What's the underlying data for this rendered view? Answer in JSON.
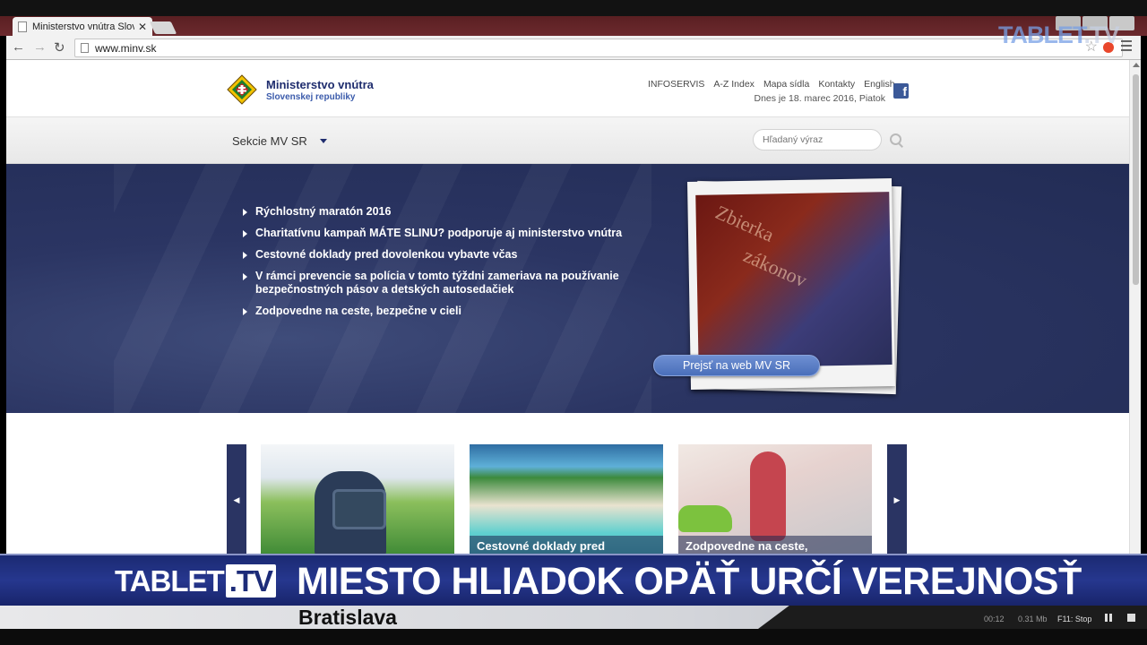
{
  "browser": {
    "tab_title": "Ministerstvo vnútra Slove",
    "tab_close": "✕",
    "url": "www.minv.sk",
    "back": "←",
    "forward": "→",
    "reload": "↻",
    "star": "☆"
  },
  "header": {
    "org_name": "Ministerstvo vnútra",
    "org_sub": "Slovenskej republiky",
    "links": [
      "INFOSERVIS",
      "A-Z Index",
      "Mapa sídla",
      "Kontakty",
      "English"
    ],
    "date_line": "Dnes je 18. marec 2016, Piatok",
    "fb": "f"
  },
  "nav": {
    "sections_label": "Sekcie MV SR",
    "search_placeholder": "Hľadaný výraz"
  },
  "banner": {
    "news": [
      "Rýchlostný maratón 2016",
      "Charitatívnu kampaň MÁTE SLINU? podporuje aj ministerstvo vnútra",
      "Cestovné doklady pred dovolenkou vybavte včas",
      "V rámci prevencie sa polícia v tomto týždni zameriava na používanie bezpečnostných pásov a detských autosedačiek",
      "Zodpovedne na ceste, bezpečne v cieli"
    ],
    "button_label": "Prejsť na web MV SR"
  },
  "carousel": {
    "prev": "◀",
    "next": "▶",
    "items": [
      {
        "caption": ""
      },
      {
        "caption": "Cestovné doklady pred"
      },
      {
        "caption": "Zodpovedne na ceste,"
      }
    ]
  },
  "tv": {
    "logo_main": "TABLET",
    "logo_tv": ".TV",
    "headline": "MIESTO HLIADOK OPÄŤ URČÍ VEREJNOSŤ",
    "location": "Bratislava",
    "status_time": "00:12",
    "status_size": "0.31 Mb",
    "status_stop": "F11: Stop"
  },
  "watermark": {
    "main": "TABLET",
    "tv": ".TV"
  },
  "colors": {
    "brand_navy": "#1f2d6e",
    "banner_bg": "#2b3563",
    "button_blue": "#4a6fba",
    "tv_bar": "#26378e"
  }
}
